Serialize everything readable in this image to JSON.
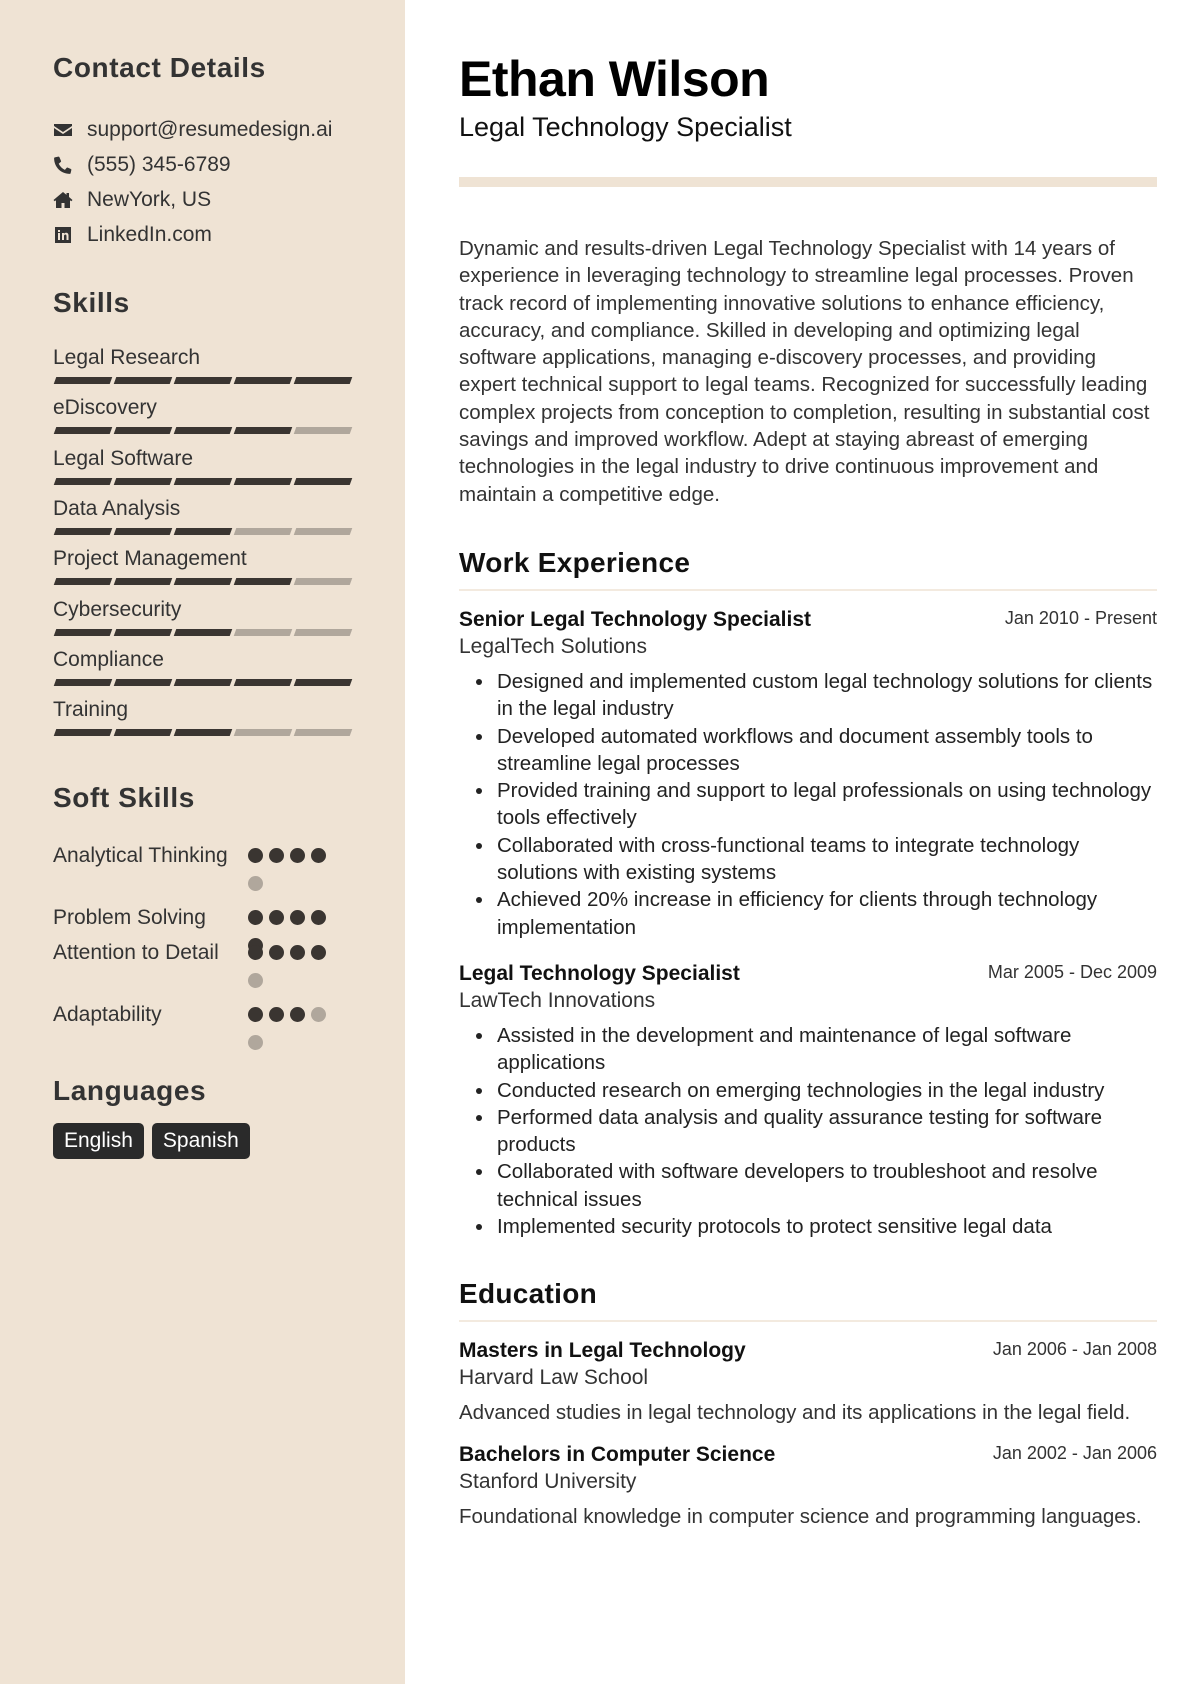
{
  "sidebar": {
    "contact": {
      "heading": "Contact Details",
      "items": [
        {
          "icon": "envelope-icon",
          "text": "support@resumedesign.ai"
        },
        {
          "icon": "phone-icon",
          "text": "(555) 345-6789"
        },
        {
          "icon": "home-icon",
          "text": "NewYork, US"
        },
        {
          "icon": "linkedin-icon",
          "text": "LinkedIn.com"
        }
      ]
    },
    "skills": {
      "heading": "Skills",
      "max_level": 5,
      "items": [
        {
          "label": "Legal Research",
          "level": 5
        },
        {
          "label": "eDiscovery",
          "level": 4
        },
        {
          "label": "Legal Software",
          "level": 5
        },
        {
          "label": "Data Analysis",
          "level": 3
        },
        {
          "label": "Project Management",
          "level": 4
        },
        {
          "label": "Cybersecurity",
          "level": 3
        },
        {
          "label": "Compliance",
          "level": 5
        },
        {
          "label": "Training",
          "level": 3
        }
      ]
    },
    "soft_skills": {
      "heading": "Soft Skills",
      "max_level": 5,
      "items": [
        {
          "label": "Analytical Thinking",
          "level": 4
        },
        {
          "label": "Problem Solving",
          "level": 5
        },
        {
          "label": "Attention to Detail",
          "level": 4
        },
        {
          "label": "Adaptability",
          "level": 3
        }
      ]
    },
    "languages": {
      "heading": "Languages",
      "items": [
        "English",
        "Spanish"
      ]
    }
  },
  "header": {
    "name": "Ethan Wilson",
    "title": "Legal Technology Specialist"
  },
  "summary": "Dynamic and results-driven Legal Technology Specialist with 14 years of experience in leveraging technology to streamline legal processes. Proven track record of implementing innovative solutions to enhance efficiency, accuracy, and compliance. Skilled in developing and optimizing legal software applications, managing e-discovery processes, and providing expert technical support to legal teams. Recognized for successfully leading complex projects from conception to completion, resulting in substantial cost savings and improved workflow. Adept at staying abreast of emerging technologies in the legal industry to drive continuous improvement and maintain a competitive edge.",
  "work_experience": {
    "heading": "Work Experience",
    "items": [
      {
        "title": "Senior Legal Technology Specialist",
        "company": "LegalTech Solutions",
        "dates": "Jan 2010 - Present",
        "bullets": [
          "Designed and implemented custom legal technology solutions for clients in the legal industry",
          "Developed automated workflows and document assembly tools to streamline legal processes",
          "Provided training and support to legal professionals on using technology tools effectively",
          "Collaborated with cross-functional teams to integrate technology solutions with existing systems",
          "Achieved 20% increase in efficiency for clients through technology implementation"
        ]
      },
      {
        "title": "Legal Technology Specialist",
        "company": "LawTech Innovations",
        "dates": "Mar 2005 - Dec 2009",
        "bullets": [
          "Assisted in the development and maintenance of legal software applications",
          "Conducted research on emerging technologies in the legal industry",
          "Performed data analysis and quality assurance testing for software products",
          "Collaborated with software developers to troubleshoot and resolve technical issues",
          "Implemented security protocols to protect sensitive legal data"
        ]
      }
    ]
  },
  "education": {
    "heading": "Education",
    "items": [
      {
        "degree": "Masters in Legal Technology",
        "school": "Harvard Law School",
        "dates": "Jan 2006 - Jan 2008",
        "description": "Advanced studies in legal technology and its applications in the legal field."
      },
      {
        "degree": "Bachelors in Computer Science",
        "school": "Stanford University",
        "dates": "Jan 2002 - Jan 2006",
        "description": "Foundational knowledge in computer science and programming languages."
      }
    ]
  },
  "colors": {
    "sidebar_bg": "#EFE3D4",
    "level_on": "#3A3531",
    "level_off": "#B0A79C",
    "badge_bg": "#2A2A2A"
  }
}
